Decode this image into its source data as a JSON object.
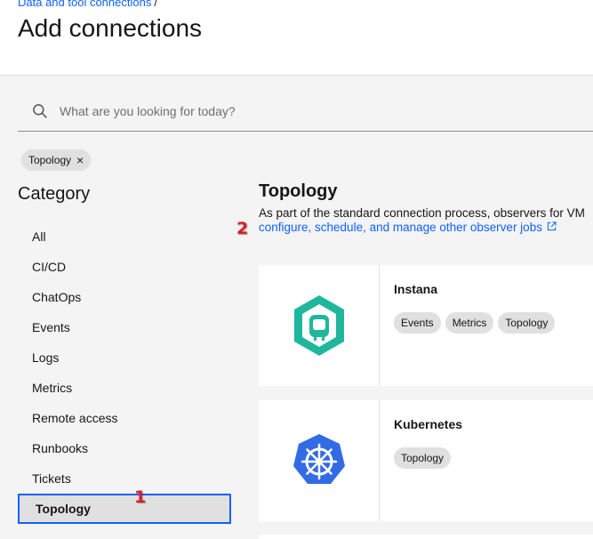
{
  "header": {
    "breadcrumb": "Data and tool connections",
    "breadcrumb_sep": "/",
    "title": "Add connections"
  },
  "search": {
    "placeholder": "What are you looking for today?"
  },
  "filter_tag": {
    "label": "Topology",
    "close": "×"
  },
  "category": {
    "title": "Category",
    "items": [
      {
        "label": "All"
      },
      {
        "label": "CI/CD"
      },
      {
        "label": "ChatOps"
      },
      {
        "label": "Events"
      },
      {
        "label": "Logs"
      },
      {
        "label": "Metrics"
      },
      {
        "label": "Remote access"
      },
      {
        "label": "Runbooks"
      },
      {
        "label": "Tickets"
      },
      {
        "label": "Topology"
      }
    ],
    "selected": "Topology"
  },
  "section": {
    "title": "Topology",
    "description": "As part of the standard connection process, observers for VM",
    "link": "configure, schedule, and manage other observer jobs"
  },
  "annotations": {
    "badge1": "1",
    "badge2": "2"
  },
  "cards": [
    {
      "name": "Instana",
      "icon": "instana-logo",
      "tags": [
        "Events",
        "Metrics",
        "Topology"
      ]
    },
    {
      "name": "Kubernetes",
      "icon": "kubernetes-logo",
      "tags": [
        "Topology"
      ]
    }
  ],
  "colors": {
    "accent": "#0f62fe",
    "instana": "#1fb69e",
    "kubernetes": "#326ce5",
    "badge": "#da1e28"
  }
}
